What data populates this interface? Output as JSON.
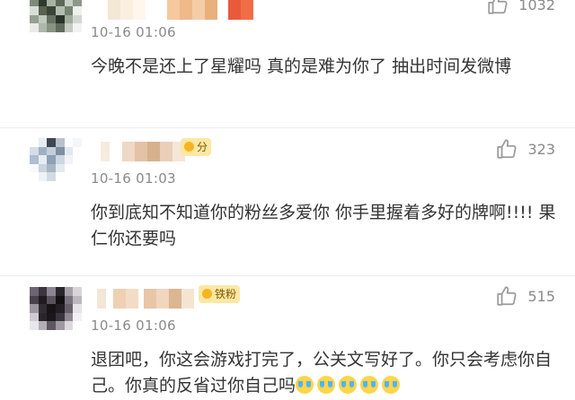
{
  "comments": [
    {
      "time": "10-16 01:06",
      "text": "今晚不是还上了星耀吗 真的是难为你了 抽出时间发微博",
      "likes": "1032",
      "badge": ""
    },
    {
      "time": "10-16 01:03",
      "text": "你到底知不知道你的粉丝多爱你 你手里握着多好的牌啊!!!! 果仁你还要吗",
      "likes": "323",
      "badge": "分"
    },
    {
      "time": "10-16 01:06",
      "text": "退团吧，你这会游戏打完了，公关文写好了。你只会考虑你自己。你真的反省过你自己吗",
      "likes": "515",
      "badge": "铁粉",
      "emoji_count": 5,
      "emoji_icon": "crying-face-icon"
    }
  ],
  "icons": {
    "like": "thumbs-up-icon"
  },
  "colors": {
    "text": "#333333",
    "meta": "#8a8a8a",
    "badge_bg": "#fde7a4",
    "badge_text": "#7a5a00"
  }
}
